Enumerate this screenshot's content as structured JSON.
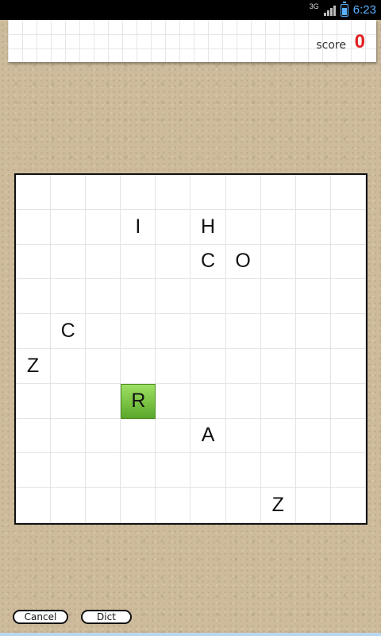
{
  "status": {
    "network": "3G",
    "time": "6:23"
  },
  "score": {
    "label": "score",
    "value": "0"
  },
  "board": {
    "rows": [
      [
        "",
        "",
        "",
        "",
        "",
        "",
        "",
        "",
        "",
        ""
      ],
      [
        "",
        "",
        "",
        "I",
        "",
        "H",
        "",
        "",
        "",
        ""
      ],
      [
        "",
        "",
        "",
        "",
        "",
        "C",
        "O",
        "",
        "",
        ""
      ],
      [
        "",
        "",
        "",
        "",
        "",
        "",
        "",
        "",
        "",
        ""
      ],
      [
        "",
        "C",
        "",
        "",
        "",
        "",
        "",
        "",
        "",
        ""
      ],
      [
        "Z",
        "",
        "",
        "",
        "",
        "",
        "",
        "",
        "",
        ""
      ],
      [
        "",
        "",
        "",
        "R",
        "",
        "",
        "",
        "",
        "",
        ""
      ],
      [
        "",
        "",
        "",
        "",
        "",
        "A",
        "",
        "",
        "",
        ""
      ],
      [
        "",
        "",
        "",
        "",
        "",
        "",
        "",
        "",
        "",
        ""
      ],
      [
        "",
        "",
        "",
        "",
        "",
        "",
        "",
        "Z",
        "",
        ""
      ]
    ],
    "selected": {
      "row": 6,
      "col": 3
    }
  },
  "buttons": {
    "cancel": "Cancel",
    "dict": "Dict"
  },
  "colors": {
    "score": "#e02020",
    "selected_tile": "#7cc444",
    "status_accent": "#5ab0ff"
  }
}
